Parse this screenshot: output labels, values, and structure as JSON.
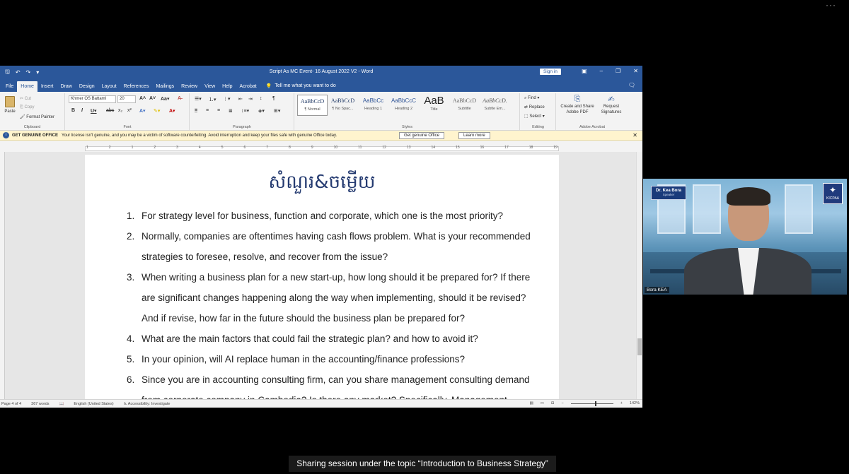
{
  "top_menu_icon": "ellipsis",
  "word": {
    "doc_title": "Script As MC Event- 16 August 2022 V2  -  Word",
    "sign_in": "Sign in",
    "tabs": [
      "File",
      "Home",
      "Insert",
      "Draw",
      "Design",
      "Layout",
      "References",
      "Mailings",
      "Review",
      "View",
      "Help",
      "Acrobat"
    ],
    "tell_me": "Tell me what you want to do",
    "ribbon": {
      "clipboard": {
        "paste": "Paste",
        "cut": "Cut",
        "copy": "Copy",
        "format_painter": "Format Painter",
        "label": "Clipboard"
      },
      "font": {
        "name": "Khmer OS Battaml",
        "size": "20",
        "label": "Font"
      },
      "paragraph": {
        "label": "Paragraph"
      },
      "styles": {
        "label": "Styles",
        "items": [
          {
            "preview": "AaBbCcD",
            "name": "¶ Normal"
          },
          {
            "preview": "AaBbCcD",
            "name": "¶ No Spac..."
          },
          {
            "preview": "AaBbCc",
            "name": "Heading 1"
          },
          {
            "preview": "AaBbCcC",
            "name": "Heading 2"
          },
          {
            "preview": "AaB",
            "name": "Title"
          },
          {
            "preview": "AaBbCcD",
            "name": "Subtitle"
          },
          {
            "preview": "AaBbCcD.",
            "name": "Subtle Em..."
          }
        ]
      },
      "editing": {
        "find": "Find",
        "replace": "Replace",
        "select": "Select",
        "label": "Editing"
      },
      "acrobat": {
        "create": "Create and Share Adobe PDF",
        "request": "Request Signatures",
        "label": "Adobe Acrobat"
      }
    },
    "license_bar": {
      "title": "GET GENUINE OFFICE",
      "message": "Your license isn't genuine, and you may be a victim of software counterfeiting. Avoid interruption and keep your files safe with genuine Office today.",
      "get_button": "Get genuine Office",
      "learn_button": "Learn more"
    },
    "ruler_numbers": [
      "1",
      "2",
      "1",
      "2",
      "3",
      "4",
      "5",
      "6",
      "7",
      "8",
      "9",
      "10",
      "11",
      "12",
      "13",
      "14",
      "15",
      "16",
      "17",
      "18",
      "19"
    ],
    "page_heading": "សំណួរ&ចម្លើយ",
    "questions": [
      {
        "n": "1.",
        "text": "For strategy level for business, function and corporate, which one is the most priority?"
      },
      {
        "n": "2.",
        "text": "Normally, companies are oftentimes having cash flows problem. What is your recommended strategies to foresee, resolve, and recover from the issue?"
      },
      {
        "n": "3.",
        "text": "When writing a business plan for a new start-up, how long should it be prepared for? If there are significant changes happening along the way when implementing, should it be revised? And if revise, how far in the future should the business plan be prepared for?"
      },
      {
        "n": "4.",
        "text": "What are the main factors that could fail the strategic plan? and how to avoid it?"
      },
      {
        "n": "5.",
        "text": "In your opinion, will AI replace human in the accounting/finance professions?"
      },
      {
        "n": "6.",
        "text": "Since you are in accounting consulting firm, can you share management consulting demand from corporate company in Cambodia? Is there any market?  Specifically, Management"
      }
    ],
    "status": {
      "page": "Page 4 of 4",
      "words": "367 words",
      "language": "English (United States)",
      "accessibility": "Accessibility: Investigate",
      "zoom": "142%",
      "zoom_level": 0.57
    }
  },
  "video": {
    "name_tag_name": "Dr. Kea Bora",
    "name_tag_role": "Speaker",
    "logo_text": "KICPAA",
    "participant_label": "Bora KEA"
  },
  "caption": "Sharing session under the topic “Introduction to Business Strategy”",
  "colors": {
    "word_blue": "#2b579a",
    "license_yellow": "#fff4ce",
    "heading_navy": "#243a70"
  }
}
